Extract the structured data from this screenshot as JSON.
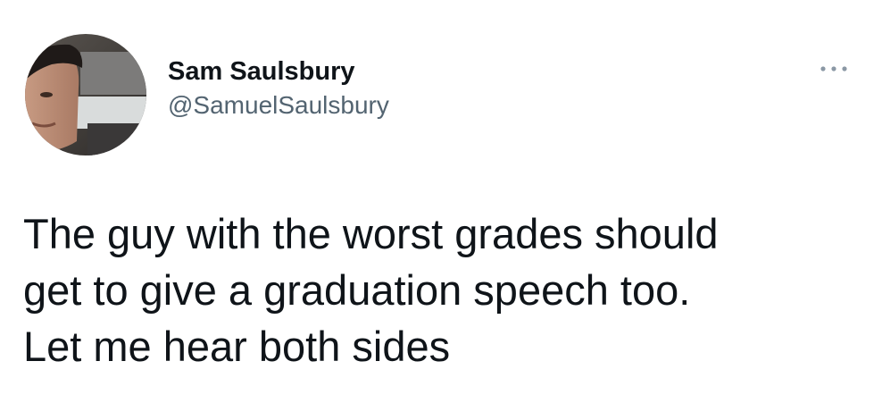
{
  "tweet": {
    "author": {
      "display_name": "Sam Saulsbury",
      "handle": "@SamuelSaulsbury"
    },
    "more_icon": "more-horizontal-icon",
    "text": "The guy with the worst grades should\nget to give a graduation speech too.\nLet me hear both sides"
  }
}
